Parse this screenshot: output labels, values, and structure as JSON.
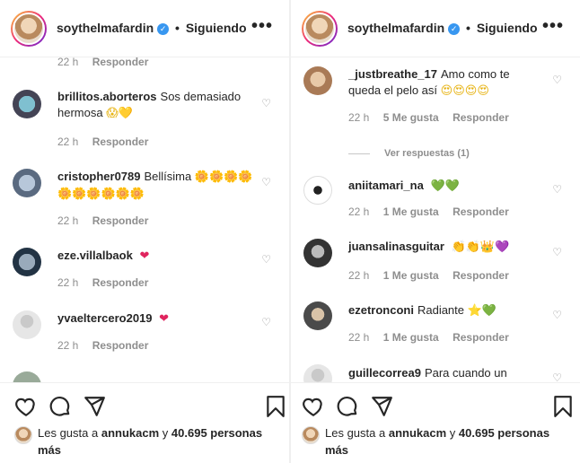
{
  "left": {
    "header": {
      "username": "soythelmafardin",
      "dot": "•",
      "follow": "Siguiendo",
      "more": "•••"
    },
    "partial_meta": {
      "time": "22 h",
      "reply": "Responder"
    },
    "comments": [
      {
        "user": "brillitos.aborteros",
        "text": "Sos demasiado hermosa",
        "emoji": "😱💛",
        "time": "22 h",
        "reply": "Responder"
      },
      {
        "user": "cristopher0789",
        "text": "Bellísima",
        "emoji": "🌼🌼🌼🌼🌼🌼🌼🌼🌼🌼",
        "time": "22 h",
        "reply": "Responder"
      },
      {
        "user": "eze.villalbaok",
        "text": "",
        "emoji": "❤",
        "time": "22 h",
        "reply": "Responder"
      },
      {
        "user": "yvaeltercero2019",
        "text": "",
        "emoji": "❤",
        "time": "22 h",
        "reply": "Responder"
      }
    ],
    "likes": {
      "prefix": "Les gusta a",
      "user": "annukacm",
      "suffix": "y",
      "count": "40.695 personas más"
    }
  },
  "right": {
    "header": {
      "username": "soythelmafardin",
      "dot": "•",
      "follow": "Siguiendo",
      "more": "•••"
    },
    "comments": [
      {
        "user": "_justbreathe_17",
        "text": "Amo como te queda el pelo así",
        "emoji": "😍😍😍😍",
        "time": "22 h",
        "likes": "5 Me gusta",
        "reply": "Responder"
      },
      {
        "user": "aniitamari_na",
        "text": "",
        "emoji": "💚💚",
        "time": "22 h",
        "likes": "1 Me gusta",
        "reply": "Responder"
      },
      {
        "user": "juansalinasguitar",
        "text": "",
        "emoji": "👏👏👑💜",
        "time": "22 h",
        "likes": "1 Me gusta",
        "reply": "Responder"
      },
      {
        "user": "ezetronconi",
        "text": "Radiante",
        "emoji": "⭐💚",
        "time": "22 h",
        "likes": "1 Me gusta",
        "reply": "Responder"
      },
      {
        "user": "guillecorrea9",
        "text": "Para cuando un",
        "emoji": "",
        "time": "",
        "likes": "",
        "reply": ""
      }
    ],
    "view_replies": "Ver respuestas (1)",
    "likes": {
      "prefix": "Les gusta a",
      "user": "annukacm",
      "suffix": "y",
      "count": "40.695 personas más"
    }
  },
  "icons": {
    "like": "heart-outline-icon",
    "comment": "comment-bubble-icon",
    "share": "paper-plane-icon",
    "save": "bookmark-icon",
    "verified": "verified-badge-icon"
  },
  "colors": {
    "verified": "#3897f0",
    "meta": "#8e8e8e",
    "text": "#262626",
    "divider": "#efefef"
  }
}
